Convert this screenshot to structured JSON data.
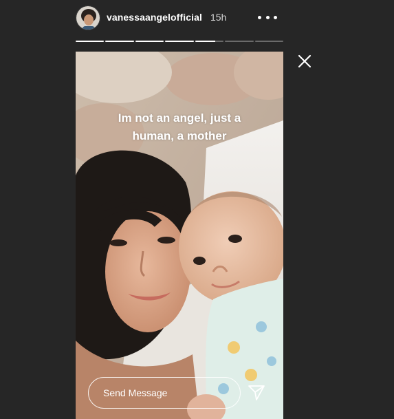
{
  "header": {
    "username": "vanessaangelofficial",
    "time_ago": "15h",
    "avatar_icon": "profile-avatar",
    "more_icon": "more-options-icon"
  },
  "progress": {
    "segments": [
      1,
      1,
      1,
      1,
      0.7,
      0,
      0
    ]
  },
  "story": {
    "caption": "Im not an angel, just a\nhuman, a mother",
    "image": "selfie of a woman with a baby lying on a bed"
  },
  "reply": {
    "placeholder": "Send Message",
    "send_icon": "send-icon"
  },
  "controls": {
    "close_icon": "close-icon"
  },
  "colors": {
    "background": "#262626",
    "text": "#ffffff",
    "progress_track": "#6a6a6a"
  }
}
